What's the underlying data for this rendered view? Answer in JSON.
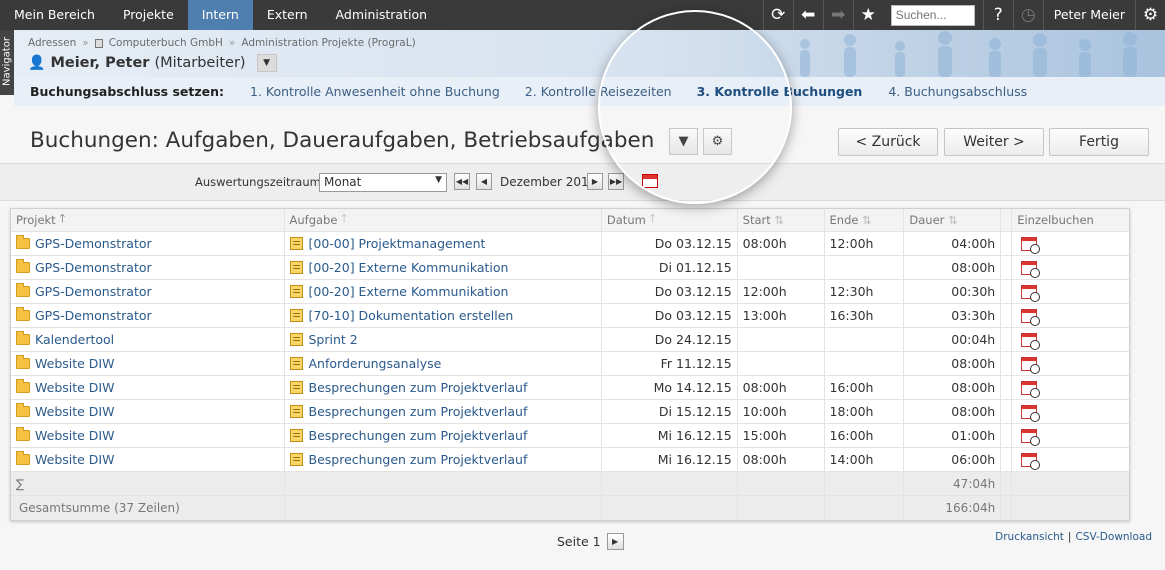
{
  "topnav": {
    "tabs": [
      {
        "label": "Mein Bereich",
        "active": false
      },
      {
        "label": "Projekte",
        "active": false
      },
      {
        "label": "Intern",
        "active": true
      },
      {
        "label": "Extern",
        "active": false
      },
      {
        "label": "Administration",
        "active": false
      }
    ],
    "search_placeholder": "Suchen...",
    "user": "Peter Meier",
    "help": "?"
  },
  "navigator_label": "Navigator",
  "breadcrumb": [
    "Adressen",
    "Computerbuch GmbH",
    "Administration Projekte (PrograL)"
  ],
  "person": {
    "name": "Meier, Peter",
    "role": "(Mitarbeiter)"
  },
  "steps": {
    "label": "Buchungsabschluss setzen:",
    "items": [
      {
        "label": "1. Kontrolle Anwesenheit ohne Buchung",
        "active": false
      },
      {
        "label": "2. Kontrolle Reisezeiten",
        "active": false
      },
      {
        "label": "3. Kontrolle Buchungen",
        "active": true
      },
      {
        "label": "4. Buchungsabschluss",
        "active": false
      }
    ]
  },
  "page_title": "Buchungen: Aufgaben, Daueraufgaben, Betriebsaufgaben",
  "buttons": {
    "back": "< Zurück",
    "next": "Weiter >",
    "finish": "Fertig"
  },
  "filter": {
    "label": "Auswertungszeitraum",
    "selected": "Monat",
    "period": "Dezember 2015"
  },
  "table": {
    "headers": [
      "Projekt",
      "Aufgabe",
      "Datum",
      "Start",
      "Ende",
      "Dauer",
      "",
      "Einzelbuchen"
    ],
    "rows": [
      {
        "projekt": "GPS-Demonstrator",
        "aufgabe": "[00-00] Projektmanagement",
        "datum": "Do 03.12.15",
        "start": "08:00h",
        "ende": "12:00h",
        "dauer": "04:00h"
      },
      {
        "projekt": "GPS-Demonstrator",
        "aufgabe": "[00-20] Externe Kommunikation",
        "datum": "Di 01.12.15",
        "start": "",
        "ende": "",
        "dauer": "08:00h"
      },
      {
        "projekt": "GPS-Demonstrator",
        "aufgabe": "[00-20] Externe Kommunikation",
        "datum": "Do 03.12.15",
        "start": "12:00h",
        "ende": "12:30h",
        "dauer": "00:30h"
      },
      {
        "projekt": "GPS-Demonstrator",
        "aufgabe": "[70-10] Dokumentation erstellen",
        "datum": "Do 03.12.15",
        "start": "13:00h",
        "ende": "16:30h",
        "dauer": "03:30h"
      },
      {
        "projekt": "Kalendertool",
        "aufgabe": "Sprint 2",
        "datum": "Do 24.12.15",
        "start": "",
        "ende": "",
        "dauer": "00:04h"
      },
      {
        "projekt": "Website DIW",
        "aufgabe": "Anforderungsanalyse",
        "datum": "Fr 11.12.15",
        "start": "",
        "ende": "",
        "dauer": "08:00h"
      },
      {
        "projekt": "Website DIW",
        "aufgabe": "Besprechungen zum Projektverlauf",
        "datum": "Mo 14.12.15",
        "start": "08:00h",
        "ende": "16:00h",
        "dauer": "08:00h"
      },
      {
        "projekt": "Website DIW",
        "aufgabe": "Besprechungen zum Projektverlauf",
        "datum": "Di 15.12.15",
        "start": "10:00h",
        "ende": "18:00h",
        "dauer": "08:00h"
      },
      {
        "projekt": "Website DIW",
        "aufgabe": "Besprechungen zum Projektverlauf",
        "datum": "Mi 16.12.15",
        "start": "15:00h",
        "ende": "16:00h",
        "dauer": "01:00h"
      },
      {
        "projekt": "Website DIW",
        "aufgabe": "Besprechungen zum Projektverlauf",
        "datum": "Mi 16.12.15",
        "start": "08:00h",
        "ende": "14:00h",
        "dauer": "06:00h"
      }
    ],
    "sum": {
      "label": "∑",
      "dauer": "47:04h"
    },
    "total": {
      "label": "Gesamtsumme (37 Zeilen)",
      "dauer": "166:04h"
    }
  },
  "pager": {
    "label": "Seite 1"
  },
  "footer_links": [
    "Druckansicht",
    "CSV-Download"
  ]
}
